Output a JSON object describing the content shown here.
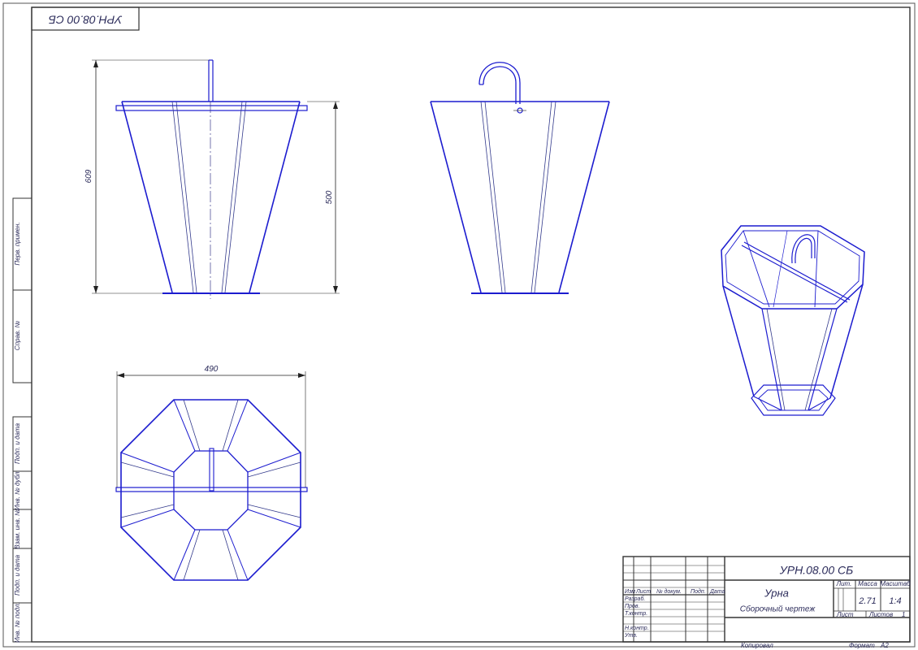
{
  "sheet": {
    "corner_designation": "УРН.08.00 СБ",
    "side_labels": [
      "Перв. примен.",
      "Справ. №",
      "Подп. и дата",
      "Инв. № дубл.",
      "Взам. инв. №",
      "Подп. и дата",
      "Инв. № подл."
    ]
  },
  "dimensions": {
    "overall_height": "609",
    "body_height": "500",
    "width": "490"
  },
  "title_block": {
    "designation": "УРН.08.00 СБ",
    "name": "Урна",
    "doc_type": "Сборочный чертеж",
    "headers": {
      "izm": "Изм",
      "list": "Лист",
      "doc_no": "№ докум.",
      "podp": "Подп.",
      "data": "Дата"
    },
    "roles": [
      "Разраб.",
      "Пров.",
      "Т.контр.",
      "",
      "Н.контр.",
      "Утв."
    ],
    "lit_label": "Лит.",
    "mass_label": "Масса",
    "scale_label": "Масштаб",
    "mass": "2.71",
    "scale": "1:4",
    "sheet_label": "Лист",
    "sheets_label": "Листов",
    "sheets_value": "1"
  },
  "footer": {
    "copied": "Копировал",
    "format_label": "Формат",
    "format_value": "A2"
  }
}
